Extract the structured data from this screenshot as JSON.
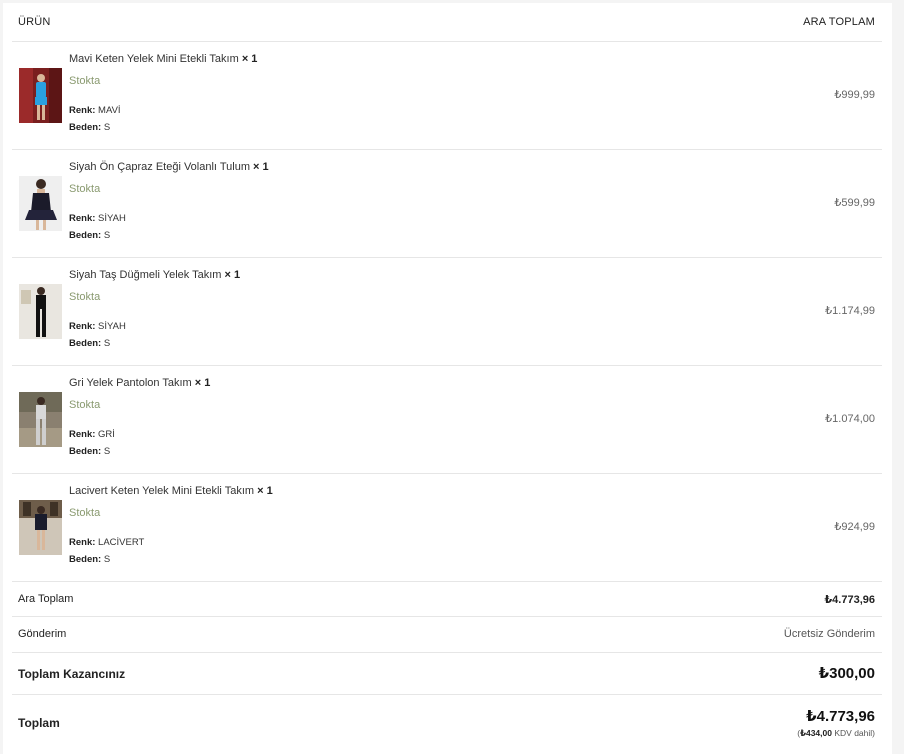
{
  "header": {
    "product_label": "ÜRÜN",
    "subtotal_label": "ARA TOPLAM"
  },
  "items": [
    {
      "name": "Mavi Keten Yelek Mini Etekli Takım",
      "qty": "× 1",
      "stock": "Stokta",
      "color_key": "Renk:",
      "color_value": "MAVİ",
      "size_key": "Beden:",
      "size_value": "S",
      "price": "₺999,99"
    },
    {
      "name": "Siyah Ön Çapraz Eteği Volanlı Tulum",
      "qty": "× 1",
      "stock": "Stokta",
      "color_key": "Renk:",
      "color_value": "SİYAH",
      "size_key": "Beden:",
      "size_value": "S",
      "price": "₺599,99"
    },
    {
      "name": "Siyah Taş Düğmeli Yelek Takım",
      "qty": "× 1",
      "stock": "Stokta",
      "color_key": "Renk:",
      "color_value": "SİYAH",
      "size_key": "Beden:",
      "size_value": "S",
      "price": "₺1.174,99"
    },
    {
      "name": "Gri Yelek Pantolon Takım",
      "qty": "× 1",
      "stock": "Stokta",
      "color_key": "Renk:",
      "color_value": "GRİ",
      "size_key": "Beden:",
      "size_value": "S",
      "price": "₺1.074,00"
    },
    {
      "name": "Lacivert Keten Yelek Mini Etekli Takım",
      "qty": "× 1",
      "stock": "Stokta",
      "color_key": "Renk:",
      "color_value": "LACİVERT",
      "size_key": "Beden:",
      "size_value": "S",
      "price": "₺924,99"
    }
  ],
  "summary": {
    "subtotal_label": "Ara Toplam",
    "subtotal_value": "₺4.773,96",
    "shipping_label": "Gönderim",
    "shipping_value": "Ücretsiz Gönderim",
    "savings_label": "Toplam Kazancınız",
    "savings_value": "₺300,00",
    "total_label": "Toplam",
    "total_value": "₺4.773,96",
    "tax_value": "₺434,00",
    "tax_note": "KDV dahil)",
    "tax_open": "("
  },
  "colors": {
    "stock": "#8a9a70",
    "divider": "#e6e6e6",
    "price_muted": "#666666"
  }
}
